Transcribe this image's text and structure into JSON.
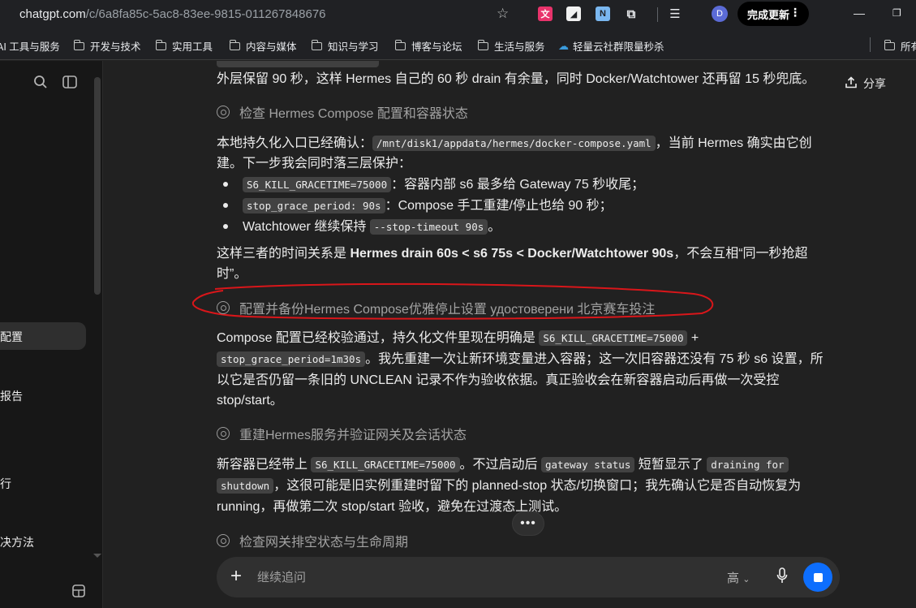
{
  "browser": {
    "url_host": "chatgpt.com",
    "url_path": "/c/6a8fa85c-5ac8-83ee-9815-011267848676",
    "profile_initial": "D",
    "update_label": "完成更新",
    "bookmarks": [
      "AI 工具与服务",
      "开发与技术",
      "实用工具",
      "内容与媒体",
      "知识与学习",
      "博客与论坛",
      "生活与服务",
      "轻量云社群限量秒杀",
      "所有"
    ]
  },
  "sidebar": {
    "items": [
      {
        "label": "配置",
        "active": true
      },
      {
        "label": "报告"
      },
      {
        "label": "行"
      },
      {
        "label": "决方法"
      }
    ]
  },
  "header": {
    "share_label": "分享"
  },
  "messages": {
    "line_top": "外层保留 90 秒，这样 Hermes 自己的 60 秒 drain 有余量，同时 Docker/Watchtower 还再留 15 秒兜底。",
    "status1": "检查 Hermes Compose 配置和容器状态",
    "p1_a": "本地持久化入口已经确认：",
    "p1_code": "/mnt/disk1/appdata/hermes/docker-compose.yaml",
    "p1_b": "，当前 Hermes 确实由它创",
    "p1_c": "建。下一步我会同时落三层保护：",
    "b1_code": "S6_KILL_GRACETIME=75000",
    "b1_text": "：容器内部 s6 最多给 Gateway 75 秒收尾；",
    "b2_code": "stop_grace_period: 90s",
    "b2_text": "：Compose 手工重建/停止也给 90 秒；",
    "b3_text": "Watchtower 继续保持 ",
    "b3_code": "--stop-timeout 90s",
    "b3_end": "。",
    "p2_a": "这样三者的时间关系是 ",
    "p2_b": "Hermes drain 60s < s6 75s < Docker/Watchtower 90s",
    "p2_c": "，不会互相“同一秒抢超",
    "p2_d": "时”。",
    "status2": "配置并备份Hermes Compose优雅停止设置 удостоверени 北京赛车投注",
    "p3_a": "Compose 配置已经校验通过，持久化文件里现在明确是 ",
    "p3_code1": "S6_KILL_GRACETIME=75000",
    "p3_plus": " +",
    "p3_code2": "stop_grace_period=1m30s",
    "p3_b": "。我先重建一次让新环境变量进入容器；这一次旧容器还没有 75 秒 s6 设置，所",
    "p3_c": "以它是否仍留一条旧的 UNCLEAN 记录不作为验收依据。真正验收会在新容器启动后再做一次受控",
    "p3_d": "stop/start。",
    "status3": "重建Hermes服务并验证网关及会话状态",
    "p4_a": "新容器已经带上 ",
    "p4_code1": "S6_KILL_GRACETIME=75000",
    "p4_b": "。不过启动后 ",
    "p4_code2": "gateway status",
    "p4_c": " 短暂显示了 ",
    "p4_code3": "draining for",
    "p4_code4": "shutdown",
    "p4_d": "，这很可能是旧实例重建时留下的 planned-stop 状态/切换窗口；我先确认它是否自动恢复为",
    "p4_e": "running，再做第二次 stop/start 验收，避免在过渡态上测试。",
    "status4": "检查网关排空状态与生命周期"
  },
  "composer": {
    "placeholder": "继续追问",
    "model_label": "高"
  },
  "colors": {
    "accent": "#0d6efd",
    "annotation": "#d9161a"
  }
}
